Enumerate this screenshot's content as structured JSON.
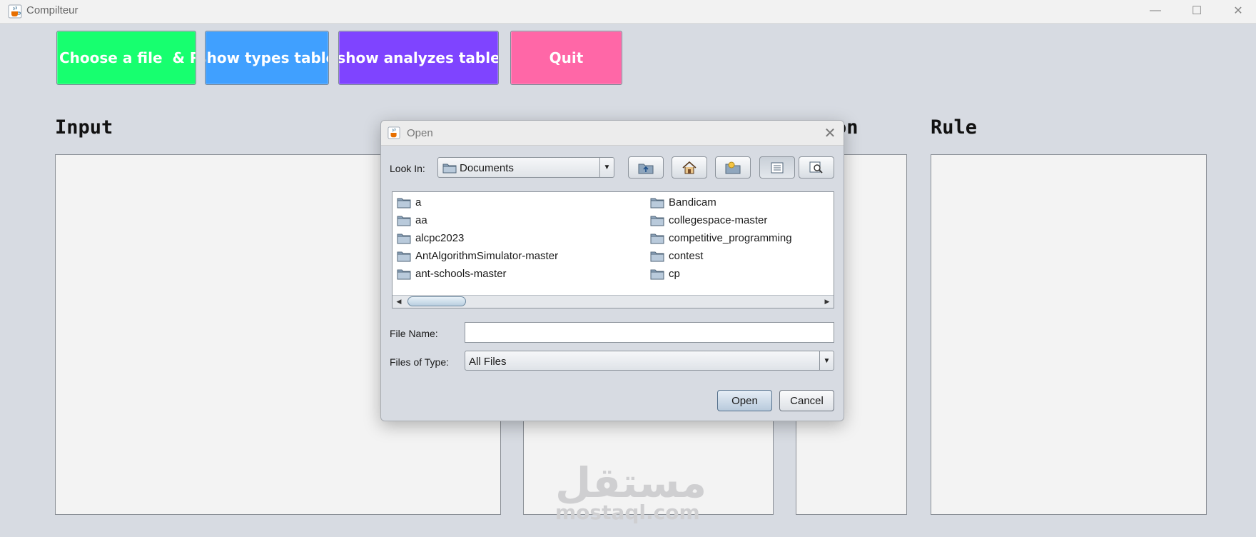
{
  "window": {
    "title": "Compilteur",
    "icon": "java-cup-icon",
    "controls": {
      "minimize": "—",
      "maximize": "☐",
      "close": "✕"
    }
  },
  "toolbar": {
    "run_label": "Choose a file  & Run",
    "types_label": "show types table",
    "analyze_label": "show analyzes table",
    "quit_label": "Quit"
  },
  "colors": {
    "run": "#17ff6f",
    "types": "#40a0ff",
    "analyze": "#7f44ff",
    "quit": "#ff67a7"
  },
  "sections": {
    "input_title": "Input",
    "action_title_visible": "on",
    "rule_title": "Rule"
  },
  "watermark": {
    "arabic": "مستقل",
    "latin": "mostaql.com"
  },
  "dialog": {
    "title": "Open",
    "look_in_label": "Look In:",
    "look_in_value": "Documents",
    "toolbar_icons": [
      "up-folder-icon",
      "home-icon",
      "new-folder-icon",
      "list-view-icon",
      "details-view-icon"
    ],
    "files_left": [
      "a",
      "aa",
      "alcpc2023",
      "AntAlgorithmSimulator-master",
      "ant-schools-master"
    ],
    "files_right": [
      "Bandicam",
      "collegespace-master",
      "competitive_programming",
      "contest",
      "cp"
    ],
    "file_name_label": "File Name:",
    "file_name_value": "",
    "files_of_type_label": "Files of Type:",
    "files_of_type_value": "All Files",
    "open_label": "Open",
    "cancel_label": "Cancel"
  }
}
